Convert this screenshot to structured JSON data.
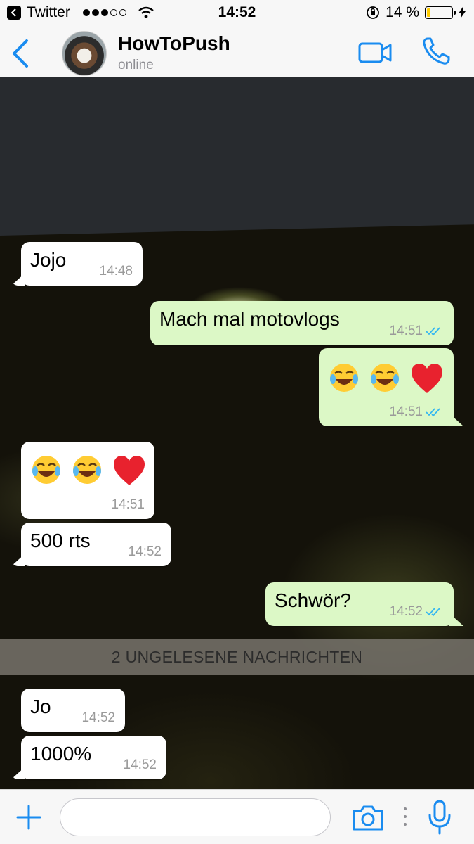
{
  "status_bar": {
    "back_app": "Twitter",
    "time": "14:52",
    "battery_percent": "14 %",
    "battery_level": 0.14,
    "signal_bars_filled": 3,
    "signal_bars_total": 5
  },
  "header": {
    "contact_name": "HowToPush",
    "contact_status": "online"
  },
  "colors": {
    "accent": "#1a8cf0",
    "outgoing_bubble": "#dcf8c6",
    "incoming_bubble": "#ffffff",
    "battery_fill": "#ffcc00"
  },
  "messages": [
    {
      "direction": "incoming",
      "text": "Jojo",
      "time": "14:48"
    },
    {
      "direction": "outgoing",
      "text": "Mach mal motovlogs",
      "time": "14:51",
      "read": true
    },
    {
      "direction": "outgoing",
      "emoji": [
        "face-with-tears-of-joy",
        "face-with-tears-of-joy",
        "red-heart"
      ],
      "time": "14:51",
      "read": true
    },
    {
      "direction": "incoming",
      "emoji": [
        "face-with-tears-of-joy",
        "face-with-tears-of-joy",
        "red-heart"
      ],
      "time": "14:51"
    },
    {
      "direction": "incoming",
      "text": "500 rts",
      "time": "14:52"
    },
    {
      "direction": "outgoing",
      "text": "Schwör?",
      "time": "14:52",
      "read": true
    },
    {
      "direction": "incoming",
      "text": "Jo",
      "time": "14:52"
    },
    {
      "direction": "incoming",
      "text": "1000%",
      "time": "14:52"
    }
  ],
  "unread_banner": "2 UNGELESENE NACHRICHTEN",
  "input_bar": {
    "message_value": "",
    "message_placeholder": ""
  },
  "icons": [
    "back-chevron-icon",
    "video-call-icon",
    "phone-icon",
    "plus-icon",
    "camera-icon",
    "more-dots-icon",
    "microphone-icon",
    "read-ticks-icon"
  ]
}
